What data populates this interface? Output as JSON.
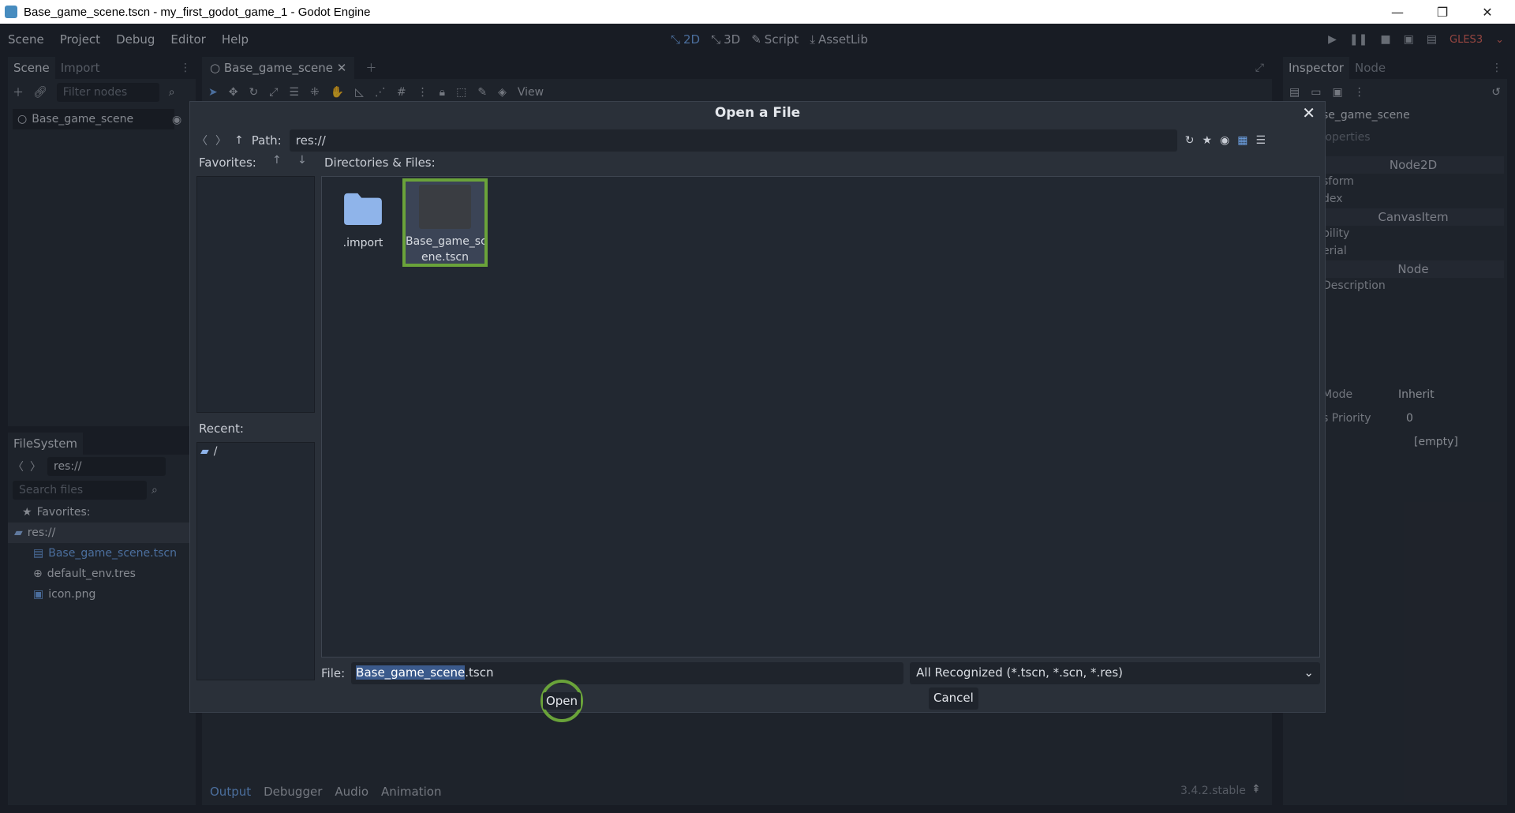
{
  "window": {
    "title": "Base_game_scene.tscn - my_first_godot_game_1 - Godot Engine",
    "min": "—",
    "max": "❐",
    "close": "✕"
  },
  "menu": [
    "Scene",
    "Project",
    "Debug",
    "Editor",
    "Help"
  ],
  "modes": {
    "two_d": "2D",
    "three_d": "3D",
    "script": "Script",
    "assetlib": "AssetLib"
  },
  "renderer": "GLES3",
  "scene_dock": {
    "tabs": [
      "Scene",
      "Import"
    ],
    "filter_placeholder": "Filter nodes",
    "root_node": "Base_game_scene"
  },
  "filesystem_dock": {
    "tab": "FileSystem",
    "path": "res://",
    "search_placeholder": "Search files",
    "favorites_label": "Favorites:",
    "root": "res://",
    "files": [
      "Base_game_scene.tscn",
      "default_env.tres",
      "icon.png"
    ]
  },
  "editor": {
    "scene_tab": "Base_game_scene",
    "view_menu": "View"
  },
  "bottom_panel": {
    "tabs": [
      "Output",
      "Debugger",
      "Audio",
      "Animation"
    ],
    "version": "3.4.2.stable"
  },
  "inspector": {
    "tabs": [
      "Inspector",
      "Node"
    ],
    "object_name": "se_game_scene",
    "filter_placeholder": "roperties",
    "sections": [
      "Node2D",
      "CanvasItem",
      "Node"
    ],
    "rows": [
      "sform",
      "dex",
      "bility",
      "erial",
      "Description"
    ],
    "props": [
      {
        "name": "Mode",
        "value": "Inherit"
      },
      {
        "name": "s Priority",
        "value": "0"
      },
      {
        "name": "",
        "value": "[empty]"
      }
    ]
  },
  "dialog": {
    "title": "Open a File",
    "path_label": "Path:",
    "path": "res://",
    "favorites_label": "Favorites:",
    "dirs_label": "Directories & Files:",
    "recent_label": "Recent:",
    "recent_items": [
      "/"
    ],
    "items": [
      {
        "name": ".import",
        "kind": "folder"
      },
      {
        "name": "Base_game_sc\nene.tscn",
        "kind": "scene",
        "selected": true
      }
    ],
    "file_label": "File:",
    "file_value_highlight": "Base_game_scene",
    "file_value_rest": ".tscn",
    "filter": "All Recognized (*.tscn, *.scn, *.res)",
    "open_button": "Open",
    "cancel_button": "Cancel"
  },
  "colors": {
    "accent": "#6fa4e8",
    "highlight_ring": "#6aa33a",
    "panel": "#2a3039",
    "background": "#21262f"
  }
}
